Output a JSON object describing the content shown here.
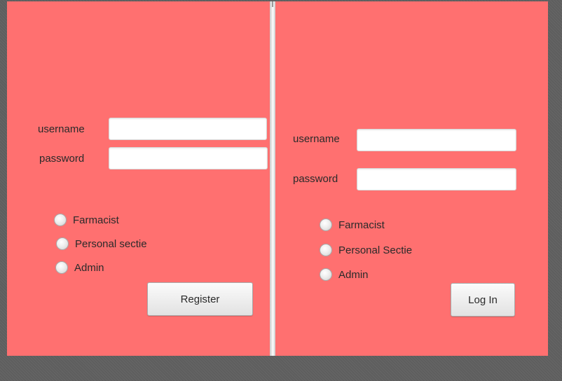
{
  "colors": {
    "panel_background": "#ff7070",
    "desktop_background": "#5e5e5e"
  },
  "register_panel": {
    "username_label": "username",
    "username_value": "",
    "password_label": "password",
    "password_value": "",
    "roles": [
      {
        "label": "Farmacist",
        "selected": false
      },
      {
        "label": "Personal sectie",
        "selected": false
      },
      {
        "label": "Admin",
        "selected": false
      }
    ],
    "register_button_label": "Register"
  },
  "login_panel": {
    "username_label": "username",
    "username_value": "",
    "password_label": "password",
    "password_value": "",
    "roles": [
      {
        "label": "Farmacist",
        "selected": false
      },
      {
        "label": "Personal Sectie",
        "selected": false
      },
      {
        "label": "Admin",
        "selected": false
      }
    ],
    "login_button_label": "Log In"
  }
}
